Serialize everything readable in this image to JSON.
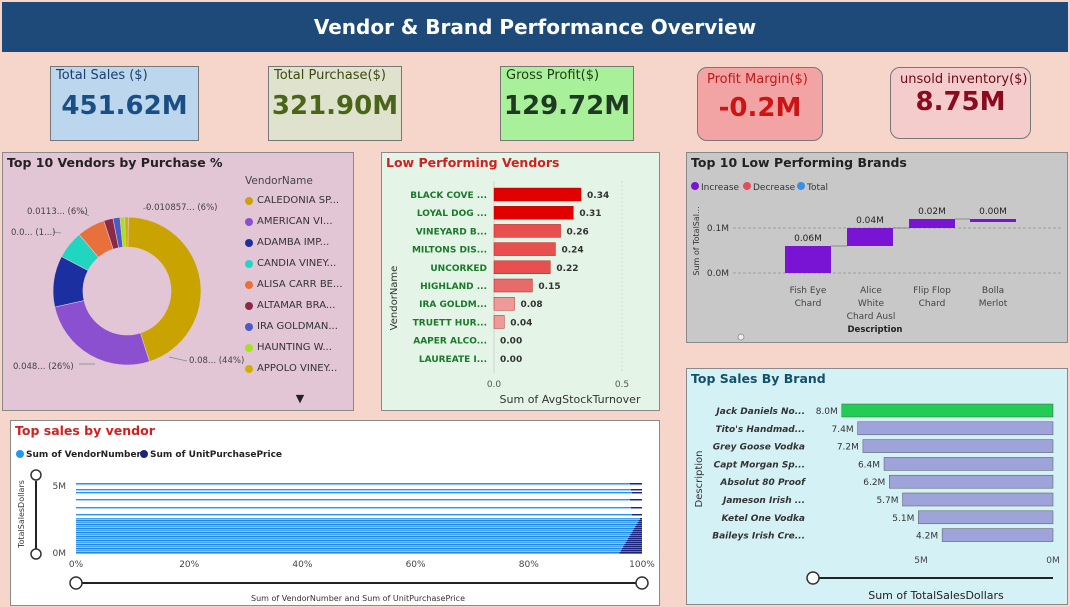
{
  "header": {
    "title": "Vendor & Brand Performance Overview"
  },
  "kpis": {
    "total_sales": {
      "label": "Total Sales ($)",
      "value": "451.62M"
    },
    "total_purchase": {
      "label": "Total Purchase($)",
      "value": "321.90M"
    },
    "gross_profit": {
      "label": "Gross Profit($)",
      "value": "129.72M"
    },
    "profit_margin": {
      "label": "Profit Margin($)",
      "value": "-0.2M"
    },
    "unsold_inventory": {
      "label": "unsold inventory($)",
      "value": "8.75M"
    }
  },
  "colors": {
    "header_bg": "#1d4a78",
    "low_vendor_bar": "#e00000",
    "top_brand_bar": "#22cc55",
    "brand_bar": "#9ea3d9",
    "waterfall_decrease": "#7a14d4"
  },
  "chart_data": [
    {
      "id": "vendor_donut",
      "type": "pie",
      "title": "Top 10 Vendors by Purchase %",
      "legend_title": "VendorName",
      "legend_placement": "right",
      "legend": [
        {
          "name": "CALEDONIA SP...",
          "color": "#c9a400"
        },
        {
          "name": "AMERICAN VI...",
          "color": "#8a50cf"
        },
        {
          "name": "ADAMBA IMP...",
          "color": "#1c2fa0"
        },
        {
          "name": "CANDIA VINEY...",
          "color": "#20d6c0"
        },
        {
          "name": "ALISA CARR BE...",
          "color": "#e8703a"
        },
        {
          "name": "ALTAMAR BRA...",
          "color": "#8b2a46"
        },
        {
          "name": "IRA GOLDMAN...",
          "color": "#4a5cc4"
        },
        {
          "name": "HAUNTING W...",
          "color": "#a6e022"
        },
        {
          "name": "APPOLO VINEY...",
          "color": "#d3b000"
        }
      ],
      "slices": [
        {
          "name": "CALEDONIA SP...",
          "value": 44,
          "color": "#c9a400"
        },
        {
          "name": "AMERICAN VI...",
          "value": 26,
          "color": "#8a50cf"
        },
        {
          "name": "ADAMBA IMP...",
          "value": 11,
          "color": "#1c2fa0"
        },
        {
          "name": "CANDIA VINEY...",
          "value": 6,
          "color": "#20d6c0"
        },
        {
          "name": "ALISA CARR BE...",
          "value": 6,
          "color": "#e8703a"
        },
        {
          "name": "ALTAMAR BRA...",
          "value": 2,
          "color": "#8b2a46"
        },
        {
          "name": "IRA GOLDMAN...",
          "value": 1.5,
          "color": "#4a5cc4"
        },
        {
          "name": "HAUNTING W...",
          "value": 1,
          "color": "#a6e022"
        },
        {
          "name": "APPOLO VINEY...",
          "value": 0.8,
          "color": "#d3b000"
        }
      ],
      "data_labels": [
        "0.0113... (6%)",
        "0.010857... (6%)",
        "0.0... (1...)",
        "0.048... (26%)",
        "0.08... (44%)"
      ]
    },
    {
      "id": "low_vendors",
      "type": "bar",
      "orientation": "horizontal",
      "title": "Low Performing Vendors",
      "ylabel": "VendorName",
      "xlabel": "Sum of AvgStockTurnover",
      "xlim": [
        0,
        0.5
      ],
      "xticks": [
        "0.0",
        "0.5"
      ],
      "categories": [
        "BLACK COVE ...",
        "LOYAL DOG ...",
        "VINEYARD B...",
        "MILTONS DIS...",
        "UNCORKED",
        "HIGHLAND ...",
        "IRA GOLDM...",
        "TRUETT HUR...",
        "AAPER ALCO...",
        "LAUREATE I..."
      ],
      "values": [
        0.34,
        0.31,
        0.26,
        0.24,
        0.22,
        0.15,
        0.08,
        0.04,
        0.0,
        0.0
      ],
      "labels": [
        "0.34",
        "0.31",
        "0.26",
        "0.24",
        "0.22",
        "0.15",
        "0.08",
        "0.04",
        "0.00",
        "0.00"
      ]
    },
    {
      "id": "low_brands_waterfall",
      "type": "bar",
      "subtype": "waterfall",
      "title": "Top 10 Low Performing Brands",
      "legend": [
        {
          "name": "Increase",
          "color": "#7a14d4"
        },
        {
          "name": "Decrease",
          "color": "#e84b5a"
        },
        {
          "name": "Total",
          "color": "#3a8ee6"
        }
      ],
      "ylabel": "Sum of TotalSal...",
      "xlabel": "Description",
      "yticks": [
        "0.1M",
        "0.0M"
      ],
      "categories": [
        "Fish Eye Chard",
        "Alice White Chard Ausl",
        "Flip Flop Chard",
        "Bolla Merlot"
      ],
      "category_lines": [
        [
          "Fish Eye",
          "Chard"
        ],
        [
          "Alice",
          "White",
          "Chard Ausl"
        ],
        [
          "Flip Flop",
          "Chard"
        ],
        [
          "Bolla",
          "Merlot"
        ]
      ],
      "values": [
        0.06,
        0.04,
        0.02,
        0.0
      ],
      "labels": [
        "0.06M",
        "0.04M",
        "0.02M",
        "0.00M"
      ],
      "ylim": [
        0,
        0.1
      ]
    },
    {
      "id": "top_brands",
      "type": "bar",
      "orientation": "horizontal",
      "title": "Top Sales By Brand",
      "ylabel": "Description",
      "xlabel": "Sum of TotalSalesDollars",
      "xticks": [
        "5M",
        "0M"
      ],
      "categories": [
        "Jack Daniels No...",
        "Tito's Handmad...",
        "Grey Goose Vodka",
        "Capt Morgan Sp...",
        "Absolut 80 Proof",
        "Jameson Irish ...",
        "Ketel One Vodka",
        "Baileys Irish Cre..."
      ],
      "values": [
        8.0,
        7.4,
        7.2,
        6.4,
        6.2,
        5.7,
        5.1,
        4.2
      ],
      "labels": [
        "8.0M",
        "7.4M",
        "7.2M",
        "6.4M",
        "6.2M",
        "5.7M",
        "5.1M",
        "4.2M"
      ]
    },
    {
      "id": "sales_by_vendor",
      "type": "bar",
      "subtype": "100% stacked",
      "title": "Top sales by vendor",
      "legend": [
        {
          "name": "Sum of VendorNumber",
          "color": "#2196f3"
        },
        {
          "name": "Sum of UnitPurchasePrice",
          "color": "#1a237e"
        }
      ],
      "ylabel": "TotalSalesDollars",
      "xlabel": "Sum of VendorNumber and Sum of UnitPurchasePrice",
      "yticks": [
        "5M",
        "0M"
      ],
      "xticks": [
        "0%",
        "20%",
        "40%",
        "60%",
        "80%",
        "100%"
      ]
    }
  ]
}
